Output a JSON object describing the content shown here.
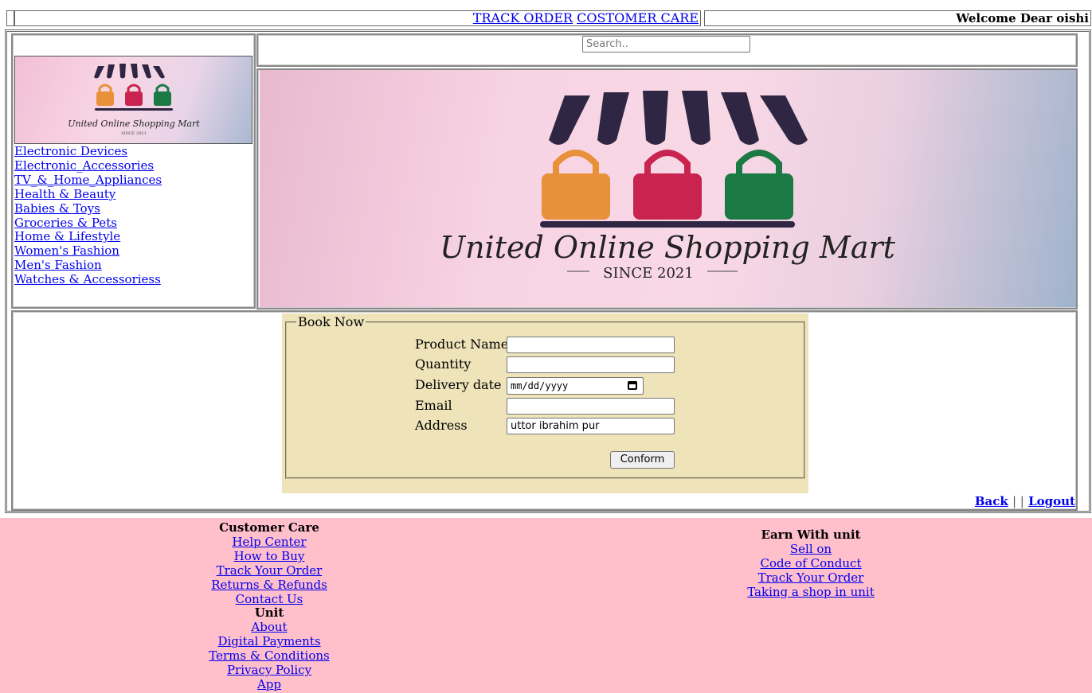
{
  "top": {
    "nav": [
      "TRACK ORDER",
      "COSTOMER CARE"
    ],
    "welcome": "Welcome Dear oishi"
  },
  "logo": {
    "name": "United Online Shopping Mart",
    "since": "SINCE 2021"
  },
  "categories": [
    "Electronic Devices",
    "Electronic_Accessories",
    "TV_&_Home_Appliances",
    "Health & Beauty",
    "Babies & Toys",
    "Groceries & Pets",
    "Home & Lifestyle",
    "Women's Fashion",
    "Men's Fashion",
    "Watches & Accessoriess"
  ],
  "search": {
    "placeholder": "Search.."
  },
  "banner": {
    "title": "United Online Shopping Mart",
    "since": "SINCE 2021"
  },
  "booking": {
    "legend": "Book Now",
    "fields": {
      "product_name": {
        "label": "Product Name",
        "value": ""
      },
      "quantity": {
        "label": "Quantity",
        "value": ""
      },
      "delivery_date": {
        "label": "Delivery date",
        "placeholder": "mm/dd/yyyy"
      },
      "email": {
        "label": "Email",
        "value": ""
      },
      "address": {
        "label": "Address",
        "value": "uttor ibrahim pur"
      }
    },
    "submit": "Conform"
  },
  "actions": {
    "back": "Back",
    "separator": "| |",
    "logout": "Logout"
  },
  "footer": {
    "customer_care": {
      "heading": "Customer Care",
      "links": [
        "Help Center",
        "How to Buy",
        "Track Your Order",
        "Returns & Refunds",
        "Contact Us"
      ]
    },
    "unit": {
      "heading": "Unit",
      "links": [
        "About",
        "Digital Payments",
        "Terms & Conditions",
        "Privacy Policy",
        "App"
      ]
    },
    "earn": {
      "heading": "Earn With unit",
      "links": [
        "Sell on",
        "Code of Conduct",
        "Track Your Order",
        "Taking a shop in unit"
      ]
    }
  },
  "colors": {
    "footer_bg": "#ffbfcb",
    "form_bg": "#eee3b9",
    "link": "#0000ee",
    "bag_orange": "#e8903a",
    "bag_red": "#c8244f",
    "bag_green": "#1b7a44",
    "awning": "#2e2643"
  }
}
